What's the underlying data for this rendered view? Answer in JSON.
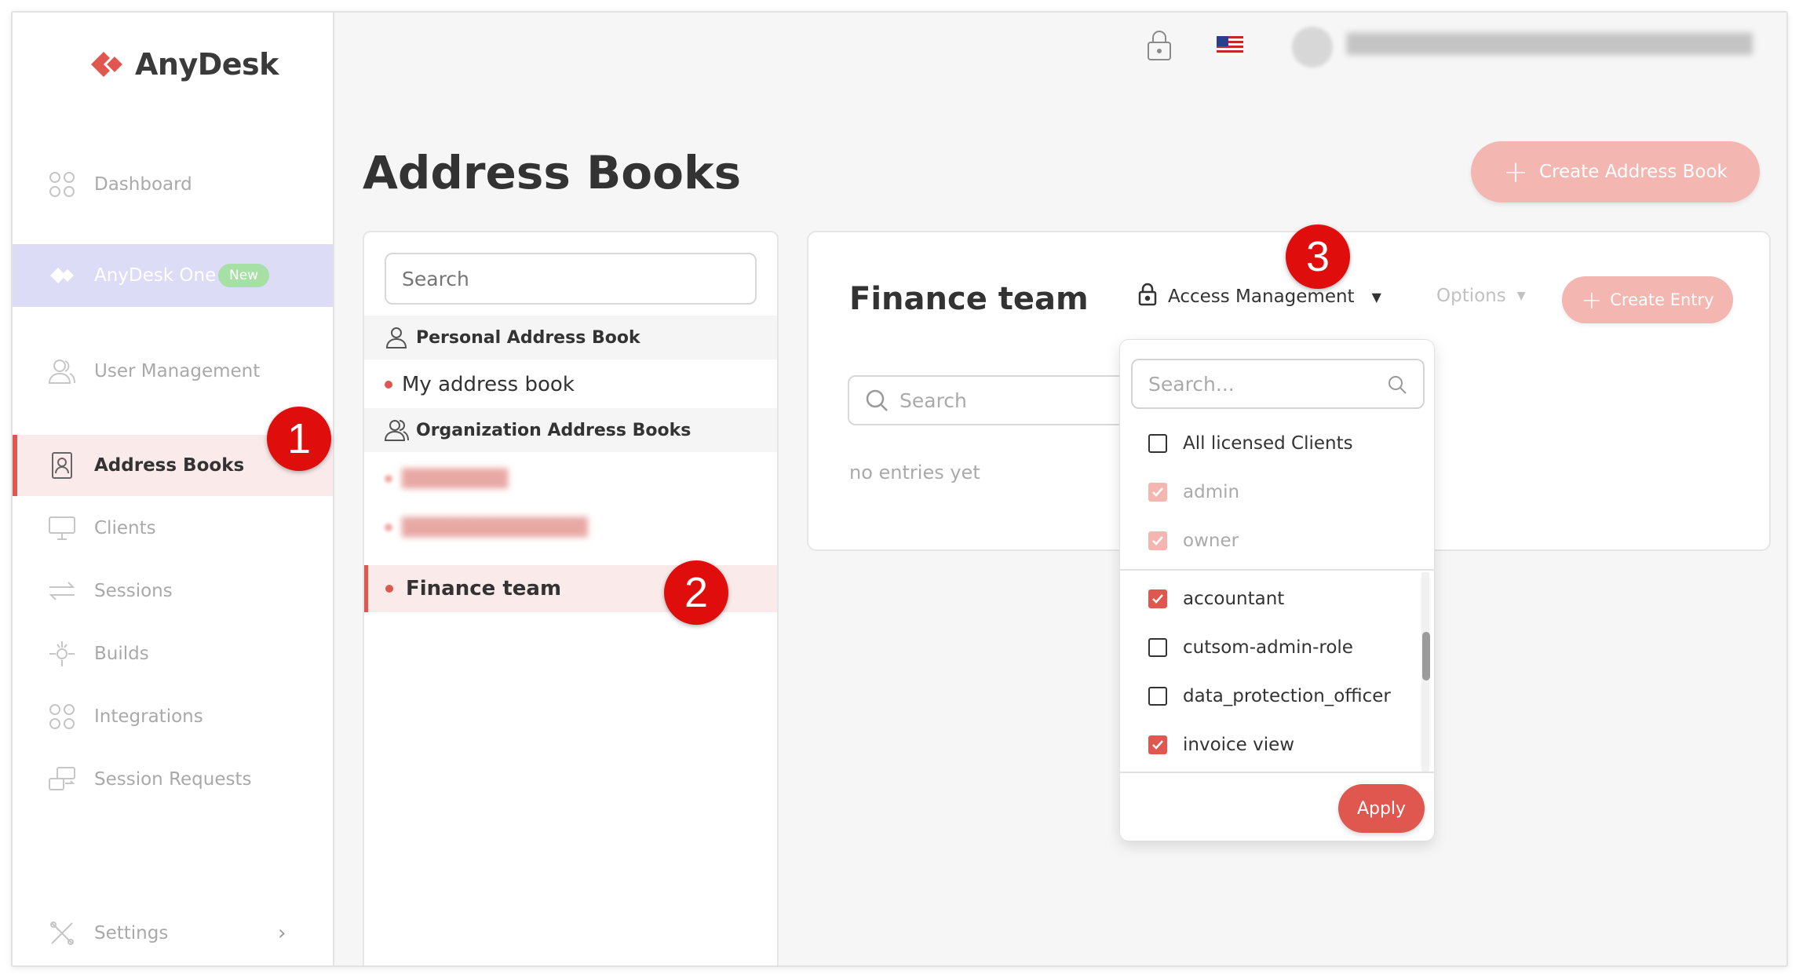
{
  "brand": {
    "name": "AnyDesk",
    "accent": "#e0574f"
  },
  "sidebar": {
    "items": [
      {
        "label": "Dashboard",
        "icon": "dashboard-icon"
      },
      {
        "label": "AnyDesk One",
        "icon": "anydesk-one-icon",
        "badge": "New"
      },
      {
        "label": "User Management",
        "icon": "users-icon"
      },
      {
        "label": "Address Books",
        "icon": "address-book-icon",
        "active": true
      },
      {
        "label": "Clients",
        "icon": "monitor-icon"
      },
      {
        "label": "Sessions",
        "icon": "sessions-icon"
      },
      {
        "label": "Builds",
        "icon": "builds-icon"
      },
      {
        "label": "Integrations",
        "icon": "integrations-icon"
      },
      {
        "label": "Session Requests",
        "icon": "session-requests-icon"
      },
      {
        "label": "Settings",
        "icon": "settings-icon"
      }
    ]
  },
  "header": {
    "language": "us-flag-icon"
  },
  "page": {
    "title": "Address Books",
    "create_button": "Create Address Book"
  },
  "address_books": {
    "search_placeholder": "Search",
    "personal_section": "Personal Address Book",
    "personal_items": [
      "My address book"
    ],
    "org_section": "Organization Address Books",
    "org_items": [
      "Finance team"
    ]
  },
  "detail": {
    "title": "Finance team",
    "access_management": "Access Management",
    "options": "Options",
    "create_entry": "Create Entry",
    "search_placeholder": "Search",
    "empty_text": "no entries yet"
  },
  "access_dropdown": {
    "search_placeholder": "Search...",
    "options": [
      {
        "label": "All licensed Clients",
        "checked": false,
        "disabled": false
      },
      {
        "label": "admin",
        "checked": true,
        "disabled": true
      },
      {
        "label": "owner",
        "checked": true,
        "disabled": true
      },
      {
        "label": "accountant",
        "checked": true,
        "disabled": false
      },
      {
        "label": "cutsom-admin-role",
        "checked": false,
        "disabled": false
      },
      {
        "label": "data_protection_officer",
        "checked": false,
        "disabled": false
      },
      {
        "label": "invoice view",
        "checked": true,
        "disabled": false
      }
    ],
    "apply": "Apply"
  },
  "markers": [
    "1",
    "2",
    "3"
  ]
}
